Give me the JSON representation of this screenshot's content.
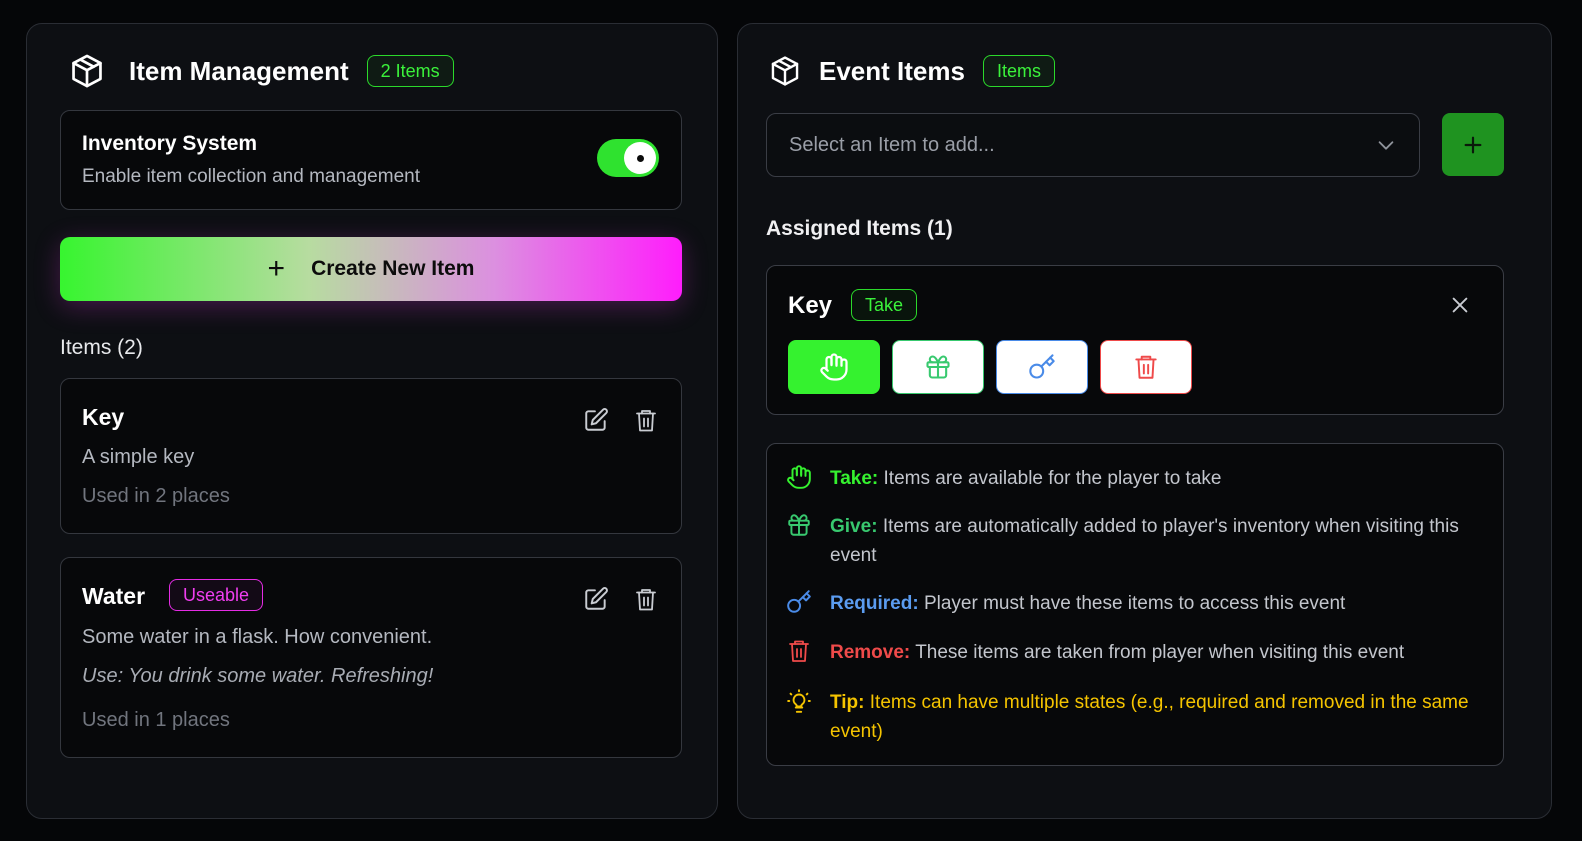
{
  "colors": {
    "accent_green": "#35f22f",
    "accent_pink": "#ff1dfc",
    "give_green": "#38c96f",
    "required_blue": "#4a8be8",
    "remove_red": "#ef4a4a",
    "tip_yellow": "#f5c400",
    "add_button": "#1f9320"
  },
  "left": {
    "icon": "cube-icon",
    "title": "Item Management",
    "count_badge": "2 Items",
    "inventory": {
      "title": "Inventory System",
      "subtitle": "Enable item collection and management",
      "enabled": true
    },
    "create_button": "Create New Item",
    "items_label": "Items (2)",
    "items": [
      {
        "name": "Key",
        "description": "A simple key",
        "usage": "Used in 2 places"
      },
      {
        "name": "Water",
        "badge": "Useable",
        "description": "Some water in a flask. How convenient.",
        "use_text": "Use: You drink some water. Refreshing!",
        "usage": "Used in 1 places"
      }
    ]
  },
  "right": {
    "icon": "cube-icon",
    "title": "Event Items",
    "badge": "Items",
    "select_placeholder": "Select an Item to add...",
    "assigned_label": "Assigned Items (1)",
    "assigned": [
      {
        "name": "Key",
        "state_badge": "Take",
        "states": [
          "take",
          "give",
          "required",
          "remove"
        ],
        "active_state": "take"
      }
    ],
    "legend": [
      {
        "icon": "hand-icon",
        "label": "Take:",
        "text": "Items are available for the player to take",
        "color": "#35f22f"
      },
      {
        "icon": "gift-icon",
        "label": "Give:",
        "text": "Items are automatically added to player's inventory when visiting this event",
        "color": "#38c96f"
      },
      {
        "icon": "key-icon",
        "label": "Required:",
        "text": "Player must have these items to access this event",
        "color": "#4a8be8"
      },
      {
        "icon": "trash-icon",
        "label": "Remove:",
        "text": "These items are taken from player when visiting this event",
        "color": "#ef4a4a"
      },
      {
        "icon": "lightbulb-icon",
        "label": "Tip:",
        "text": "Items can have multiple states (e.g., required and removed in the same event)",
        "color": "#f5c400"
      }
    ]
  }
}
